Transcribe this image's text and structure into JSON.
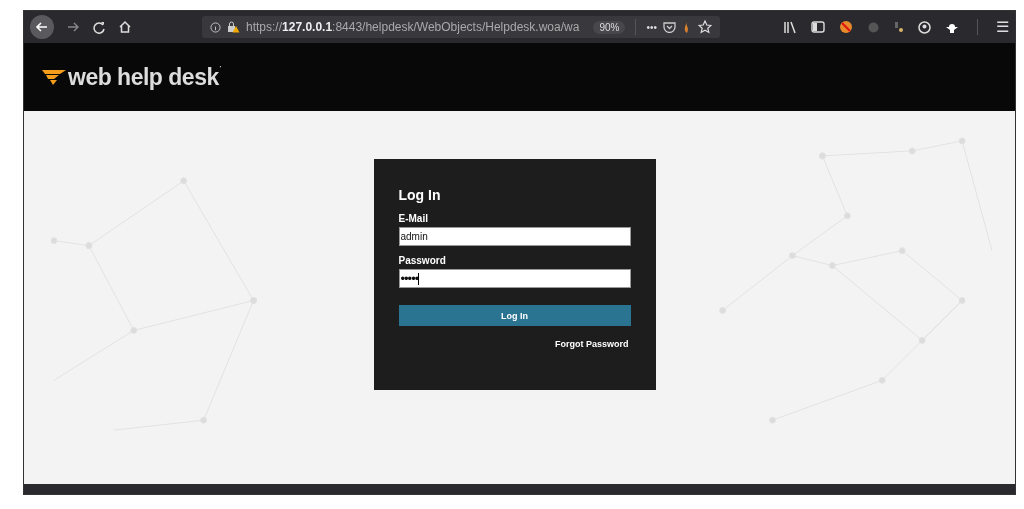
{
  "browser": {
    "url_prefix": "https://",
    "url_host": "127.0.0.1",
    "url_rest": ":8443/helpdesk/WebObjects/Helpdesk.woa/wa",
    "zoom": "90%",
    "more": "•••",
    "menu": "☰"
  },
  "header": {
    "logo": "web help desk",
    "logo_mark": "·"
  },
  "login": {
    "title": "Log In",
    "fields": [
      {
        "label": "E-Mail",
        "value": "admin",
        "kind": "text"
      },
      {
        "label": "Password",
        "value": "•••••",
        "kind": "password"
      }
    ],
    "button": "Log In",
    "link": "Forgot Password"
  }
}
